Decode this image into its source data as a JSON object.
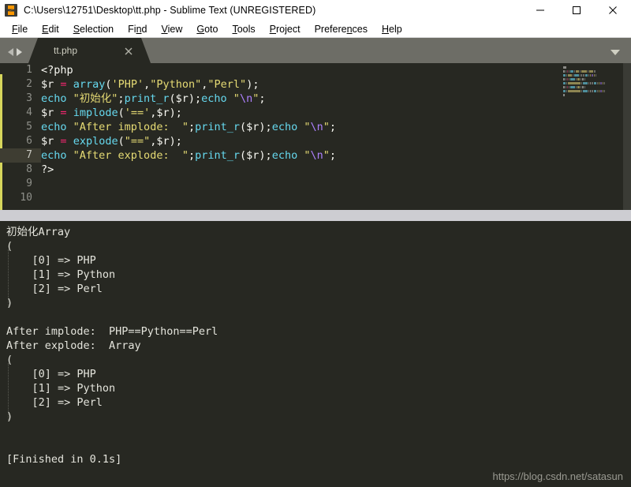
{
  "window": {
    "title": "C:\\Users\\12751\\Desktop\\tt.php - Sublime Text (UNREGISTERED)",
    "logo_icon": "sublime-text-logo",
    "controls": [
      {
        "name": "minimize",
        "icon": "minimize-icon"
      },
      {
        "name": "maximize",
        "icon": "maximize-icon"
      },
      {
        "name": "close",
        "icon": "close-icon"
      }
    ]
  },
  "menubar": {
    "items": [
      {
        "label": "File",
        "accel": "F"
      },
      {
        "label": "Edit",
        "accel": "E"
      },
      {
        "label": "Selection",
        "accel": "S"
      },
      {
        "label": "Find",
        "accel": "n"
      },
      {
        "label": "View",
        "accel": "V"
      },
      {
        "label": "Goto",
        "accel": "G"
      },
      {
        "label": "Tools",
        "accel": "T"
      },
      {
        "label": "Project",
        "accel": "P"
      },
      {
        "label": "Preferences",
        "accel": "n"
      },
      {
        "label": "Help",
        "accel": "H"
      }
    ]
  },
  "tabbar": {
    "prev_icon": "chevron-left-icon",
    "next_icon": "chevron-right-icon",
    "tabs": [
      {
        "label": "tt.php",
        "close_icon": "close-icon",
        "active": true
      }
    ],
    "dropdown_icon": "chevron-down-icon"
  },
  "editor": {
    "active_line": 7,
    "line_numbers": [
      "1",
      "2",
      "3",
      "4",
      "5",
      "6",
      "7",
      "8",
      "9",
      "10"
    ],
    "lines": [
      {
        "n": 1,
        "tokens": [
          {
            "t": "<?php",
            "c": "tk-php"
          }
        ]
      },
      {
        "n": 2,
        "tokens": [
          {
            "t": "$r",
            "c": "tk-var"
          },
          {
            "t": " ",
            "c": "tk-pun"
          },
          {
            "t": "=",
            "c": "tk-op"
          },
          {
            "t": " ",
            "c": "tk-pun"
          },
          {
            "t": "array",
            "c": "tk-fn"
          },
          {
            "t": "(",
            "c": "tk-pun"
          },
          {
            "t": "'PHP'",
            "c": "tk-str"
          },
          {
            "t": ",",
            "c": "tk-pun"
          },
          {
            "t": "\"Python\"",
            "c": "tk-str"
          },
          {
            "t": ",",
            "c": "tk-pun"
          },
          {
            "t": "\"Perl\"",
            "c": "tk-str"
          },
          {
            "t": ");",
            "c": "tk-pun"
          }
        ]
      },
      {
        "n": 3,
        "tokens": [
          {
            "t": "echo",
            "c": "tk-kw"
          },
          {
            "t": " ",
            "c": "tk-pun"
          },
          {
            "t": "\"初始化\"",
            "c": "tk-str"
          },
          {
            "t": ";",
            "c": "tk-pun"
          },
          {
            "t": "print_r",
            "c": "tk-fn"
          },
          {
            "t": "(",
            "c": "tk-pun"
          },
          {
            "t": "$r",
            "c": "tk-var"
          },
          {
            "t": ");",
            "c": "tk-pun"
          },
          {
            "t": "echo",
            "c": "tk-kw"
          },
          {
            "t": " ",
            "c": "tk-pun"
          },
          {
            "t": "\"",
            "c": "tk-str"
          },
          {
            "t": "\\n",
            "c": "tk-esc"
          },
          {
            "t": "\"",
            "c": "tk-str"
          },
          {
            "t": ";",
            "c": "tk-pun"
          }
        ]
      },
      {
        "n": 4,
        "tokens": [
          {
            "t": "$r",
            "c": "tk-var"
          },
          {
            "t": " ",
            "c": "tk-pun"
          },
          {
            "t": "=",
            "c": "tk-op"
          },
          {
            "t": " ",
            "c": "tk-pun"
          },
          {
            "t": "implode",
            "c": "tk-fn"
          },
          {
            "t": "(",
            "c": "tk-pun"
          },
          {
            "t": "'=='",
            "c": "tk-str"
          },
          {
            "t": ",",
            "c": "tk-pun"
          },
          {
            "t": "$r",
            "c": "tk-var"
          },
          {
            "t": ");",
            "c": "tk-pun"
          }
        ]
      },
      {
        "n": 5,
        "tokens": [
          {
            "t": "echo",
            "c": "tk-kw"
          },
          {
            "t": " ",
            "c": "tk-pun"
          },
          {
            "t": "\"After implode:  \"",
            "c": "tk-str"
          },
          {
            "t": ";",
            "c": "tk-pun"
          },
          {
            "t": "print_r",
            "c": "tk-fn"
          },
          {
            "t": "(",
            "c": "tk-pun"
          },
          {
            "t": "$r",
            "c": "tk-var"
          },
          {
            "t": ");",
            "c": "tk-pun"
          },
          {
            "t": "echo",
            "c": "tk-kw"
          },
          {
            "t": " ",
            "c": "tk-pun"
          },
          {
            "t": "\"",
            "c": "tk-str"
          },
          {
            "t": "\\n",
            "c": "tk-esc"
          },
          {
            "t": "\"",
            "c": "tk-str"
          },
          {
            "t": ";",
            "c": "tk-pun"
          }
        ]
      },
      {
        "n": 6,
        "tokens": [
          {
            "t": "$r",
            "c": "tk-var"
          },
          {
            "t": " ",
            "c": "tk-pun"
          },
          {
            "t": "=",
            "c": "tk-op"
          },
          {
            "t": " ",
            "c": "tk-pun"
          },
          {
            "t": "explode",
            "c": "tk-fn"
          },
          {
            "t": "(",
            "c": "tk-pun"
          },
          {
            "t": "\"==\"",
            "c": "tk-str"
          },
          {
            "t": ",",
            "c": "tk-pun"
          },
          {
            "t": "$r",
            "c": "tk-var"
          },
          {
            "t": ");",
            "c": "tk-pun"
          }
        ]
      },
      {
        "n": 7,
        "tokens": [
          {
            "t": "echo",
            "c": "tk-kw"
          },
          {
            "t": " ",
            "c": "tk-pun"
          },
          {
            "t": "\"After explode:  \"",
            "c": "tk-str"
          },
          {
            "t": ";",
            "c": "tk-pun"
          },
          {
            "t": "print_r",
            "c": "tk-fn"
          },
          {
            "t": "(",
            "c": "tk-pun"
          },
          {
            "t": "$r",
            "c": "tk-var"
          },
          {
            "t": ");",
            "c": "tk-pun"
          },
          {
            "t": "echo",
            "c": "tk-kw"
          },
          {
            "t": " ",
            "c": "tk-pun"
          },
          {
            "t": "\"",
            "c": "tk-str"
          },
          {
            "t": "\\n",
            "c": "tk-esc"
          },
          {
            "t": "\"",
            "c": "tk-str"
          },
          {
            "t": ";",
            "c": "tk-pun"
          }
        ]
      },
      {
        "n": 8,
        "tokens": [
          {
            "t": "?>",
            "c": "tk-close"
          }
        ]
      },
      {
        "n": 9,
        "tokens": []
      },
      {
        "n": 10,
        "tokens": []
      }
    ]
  },
  "output": {
    "lines": [
      "初始化Array",
      "(",
      "    [0] => PHP",
      "    [1] => Python",
      "    [2] => Perl",
      ")",
      "",
      "After implode:  PHP==Python==Perl",
      "After explode:  Array",
      "(",
      "    [0] => PHP",
      "    [1] => Python",
      "    [2] => Perl",
      ")",
      "",
      "",
      "[Finished in 0.1s]"
    ]
  },
  "watermark": {
    "text": "https://blog.csdn.net/satasun"
  },
  "colors": {
    "editor_bg": "#272822",
    "titlebar_bg": "#ffffff",
    "tabbar_bg": "#6d6d66",
    "divider": "#cdcdd2",
    "accent_orange": "#ff9800",
    "keyword": "#66d9ef",
    "string": "#e6db74",
    "operator": "#f92672",
    "escape": "#ae81ff",
    "modified_marker": "#d6d65c",
    "active_line": "#3e3d32"
  }
}
